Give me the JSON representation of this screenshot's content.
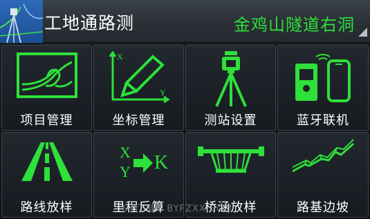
{
  "header": {
    "title": "工地通路测",
    "project_name": "金鸡山隧道右洞"
  },
  "menu": [
    {
      "label": "项目管理",
      "icon": "project-curve-icon"
    },
    {
      "label": "坐标管理",
      "icon": "coordinate-pencil-icon"
    },
    {
      "label": "测站设置",
      "icon": "tripod-station-icon"
    },
    {
      "label": "蓝牙联机",
      "icon": "bluetooth-devices-icon"
    },
    {
      "label": "路线放样",
      "icon": "road-lane-icon"
    },
    {
      "label": "里程反算",
      "icon": "xy-to-k-icon"
    },
    {
      "label": "桥涵放样",
      "icon": "bridge-icon"
    },
    {
      "label": "路基边坡",
      "icon": "slope-profile-icon"
    }
  ],
  "icon_text": {
    "x": "X",
    "y": "Y",
    "k": "K",
    "axis_x": "X",
    "axis_y": "Y"
  },
  "watermark": "飞飞下载 · BYFZXX.COM",
  "colors": {
    "accent": "#2ee03a",
    "header_bg": "#2f353b",
    "tile_bg": "#1c2227"
  }
}
